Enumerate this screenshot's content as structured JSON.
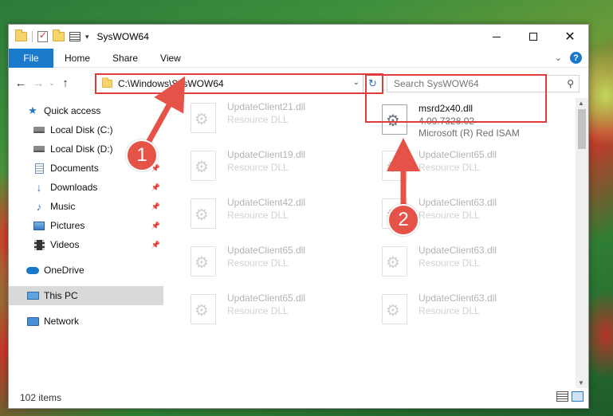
{
  "window": {
    "title": "SysWOW64"
  },
  "ribbon": {
    "file_label": "File",
    "tabs": [
      "Home",
      "Share",
      "View"
    ],
    "help_glyph": "?"
  },
  "nav": {
    "address": "C:\\Windows\\SysWOW64",
    "search_placeholder": "Search SysWOW64"
  },
  "sidebar": {
    "items": [
      {
        "label": "Quick access",
        "icon": "star-icon"
      },
      {
        "label": "Local Disk (C:)",
        "icon": "disk-icon"
      },
      {
        "label": "Local Disk (D:)",
        "icon": "disk-icon"
      },
      {
        "label": "Documents",
        "icon": "documents-icon"
      },
      {
        "label": "Downloads",
        "icon": "download-icon"
      },
      {
        "label": "Music",
        "icon": "music-icon"
      },
      {
        "label": "Pictures",
        "icon": "pictures-icon"
      },
      {
        "label": "Videos",
        "icon": "videos-icon"
      },
      {
        "label": "OneDrive",
        "icon": "onedrive-icon"
      },
      {
        "label": "This PC",
        "icon": "pc-icon"
      },
      {
        "label": "Network",
        "icon": "network-icon"
      }
    ]
  },
  "files": {
    "highlighted": {
      "name": "msrd2x40.dll",
      "version": "4.00.7328.02",
      "desc": "Microsoft (R) Red ISAM"
    },
    "faded": [
      {
        "name": "UpdateClient21.dll",
        "desc": "Resource DLL"
      },
      {
        "name": "UpdateClient19.dll",
        "desc": "Resource DLL"
      },
      {
        "name": "UpdateClient65.dll",
        "desc": "Resource DLL"
      },
      {
        "name": "UpdateClient42.dll",
        "desc": "Resource DLL"
      },
      {
        "name": "UpdateClient63.dll",
        "desc": "Resource DLL"
      },
      {
        "name": "UpdateClient65.dll",
        "desc": "Resource DLL"
      },
      {
        "name": "UpdateClient63.dll",
        "desc": "Resource DLL"
      },
      {
        "name": "UpdateClient65.dll",
        "desc": "Resource DLL"
      },
      {
        "name": "UpdateClient63.dll",
        "desc": "Resource DLL"
      }
    ]
  },
  "status": {
    "item_count": "102 items"
  },
  "annotations": {
    "badge1": "1",
    "badge2": "2",
    "color": "#e55348"
  }
}
